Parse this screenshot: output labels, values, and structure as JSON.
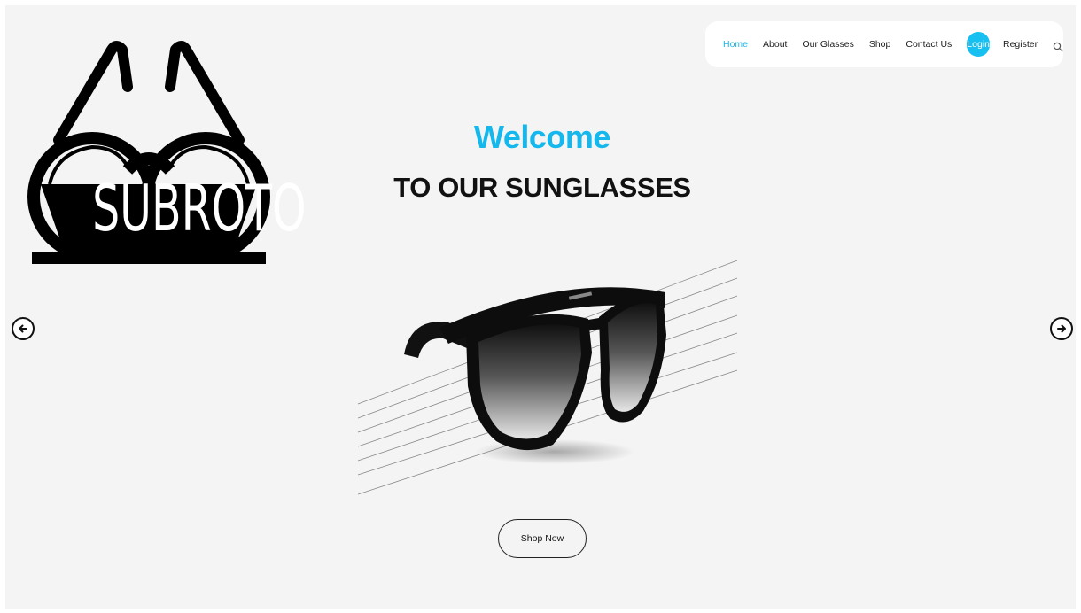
{
  "brand": {
    "logo_text": "SUBROTO",
    "logo_icon": "sunglasses-logo-icon"
  },
  "nav": {
    "items": [
      {
        "label": "Home",
        "active": true
      },
      {
        "label": "About",
        "active": false
      },
      {
        "label": "Our Glasses",
        "active": false
      },
      {
        "label": "Shop",
        "active": false
      },
      {
        "label": "Contact Us",
        "active": false
      }
    ],
    "login_label": "Login",
    "register_label": "Register",
    "search_icon": "search-icon"
  },
  "hero": {
    "title": "Welcome",
    "subtitle": "TO OUR SUNGLASSES",
    "cta_label": "Shop Now",
    "prev_icon": "arrow-left-icon",
    "next_icon": "arrow-right-icon"
  },
  "colors": {
    "accent": "#17c0f0",
    "text": "#111111",
    "background": "#f4f4f4"
  }
}
